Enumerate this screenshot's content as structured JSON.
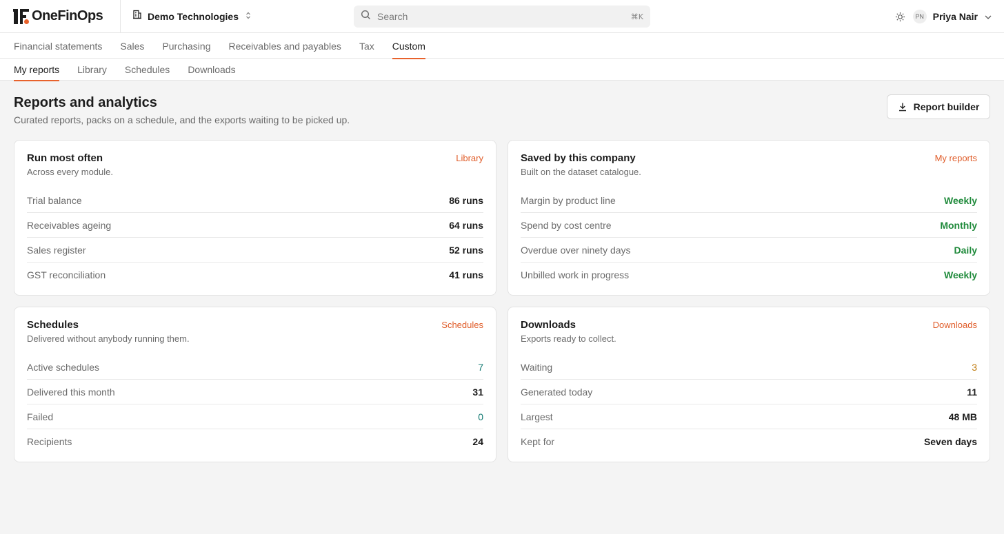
{
  "brand": {
    "name": "OneFinOps"
  },
  "company": {
    "name": "Demo Technologies"
  },
  "search": {
    "placeholder": "Search",
    "shortcut": "⌘K"
  },
  "user": {
    "initials": "PN",
    "name": "Priya Nair"
  },
  "nav_primary": [
    "Financial statements",
    "Sales",
    "Purchasing",
    "Receivables and payables",
    "Tax",
    "Custom"
  ],
  "nav_primary_active": "Custom",
  "nav_secondary": [
    "My reports",
    "Library",
    "Schedules",
    "Downloads"
  ],
  "nav_secondary_active": "My reports",
  "page": {
    "title": "Reports and analytics",
    "subtitle": "Curated reports, packs on a schedule, and the exports waiting to be picked up.",
    "builder_label": "Report builder"
  },
  "cards": {
    "run_most_often": {
      "title": "Run most often",
      "subtitle": "Across every module.",
      "link": "Library",
      "rows": [
        {
          "label": "Trial balance",
          "value": "86 runs"
        },
        {
          "label": "Receivables ageing",
          "value": "64 runs"
        },
        {
          "label": "Sales register",
          "value": "52 runs"
        },
        {
          "label": "GST reconciliation",
          "value": "41 runs"
        }
      ]
    },
    "saved": {
      "title": "Saved by this company",
      "subtitle": "Built on the dataset catalogue.",
      "link": "My reports",
      "rows": [
        {
          "label": "Margin by product line",
          "value": "Weekly"
        },
        {
          "label": "Spend by cost centre",
          "value": "Monthly"
        },
        {
          "label": "Overdue over ninety days",
          "value": "Daily"
        },
        {
          "label": "Unbilled work in progress",
          "value": "Weekly"
        }
      ]
    },
    "schedules": {
      "title": "Schedules",
      "subtitle": "Delivered without anybody running them.",
      "link": "Schedules",
      "rows": [
        {
          "label": "Active schedules",
          "value": "7"
        },
        {
          "label": "Delivered this month",
          "value": "31"
        },
        {
          "label": "Failed",
          "value": "0"
        },
        {
          "label": "Recipients",
          "value": "24"
        }
      ]
    },
    "downloads": {
      "title": "Downloads",
      "subtitle": "Exports ready to collect.",
      "link": "Downloads",
      "rows": [
        {
          "label": "Waiting",
          "value": "3"
        },
        {
          "label": "Generated today",
          "value": "11"
        },
        {
          "label": "Largest",
          "value": "48 MB"
        },
        {
          "label": "Kept for",
          "value": "Seven days"
        }
      ]
    }
  },
  "colors": {
    "accent": "#e8622c",
    "link": "#e05d2a",
    "green": "#1f8a3b",
    "teal": "#137a72",
    "amber": "#c07d12"
  }
}
